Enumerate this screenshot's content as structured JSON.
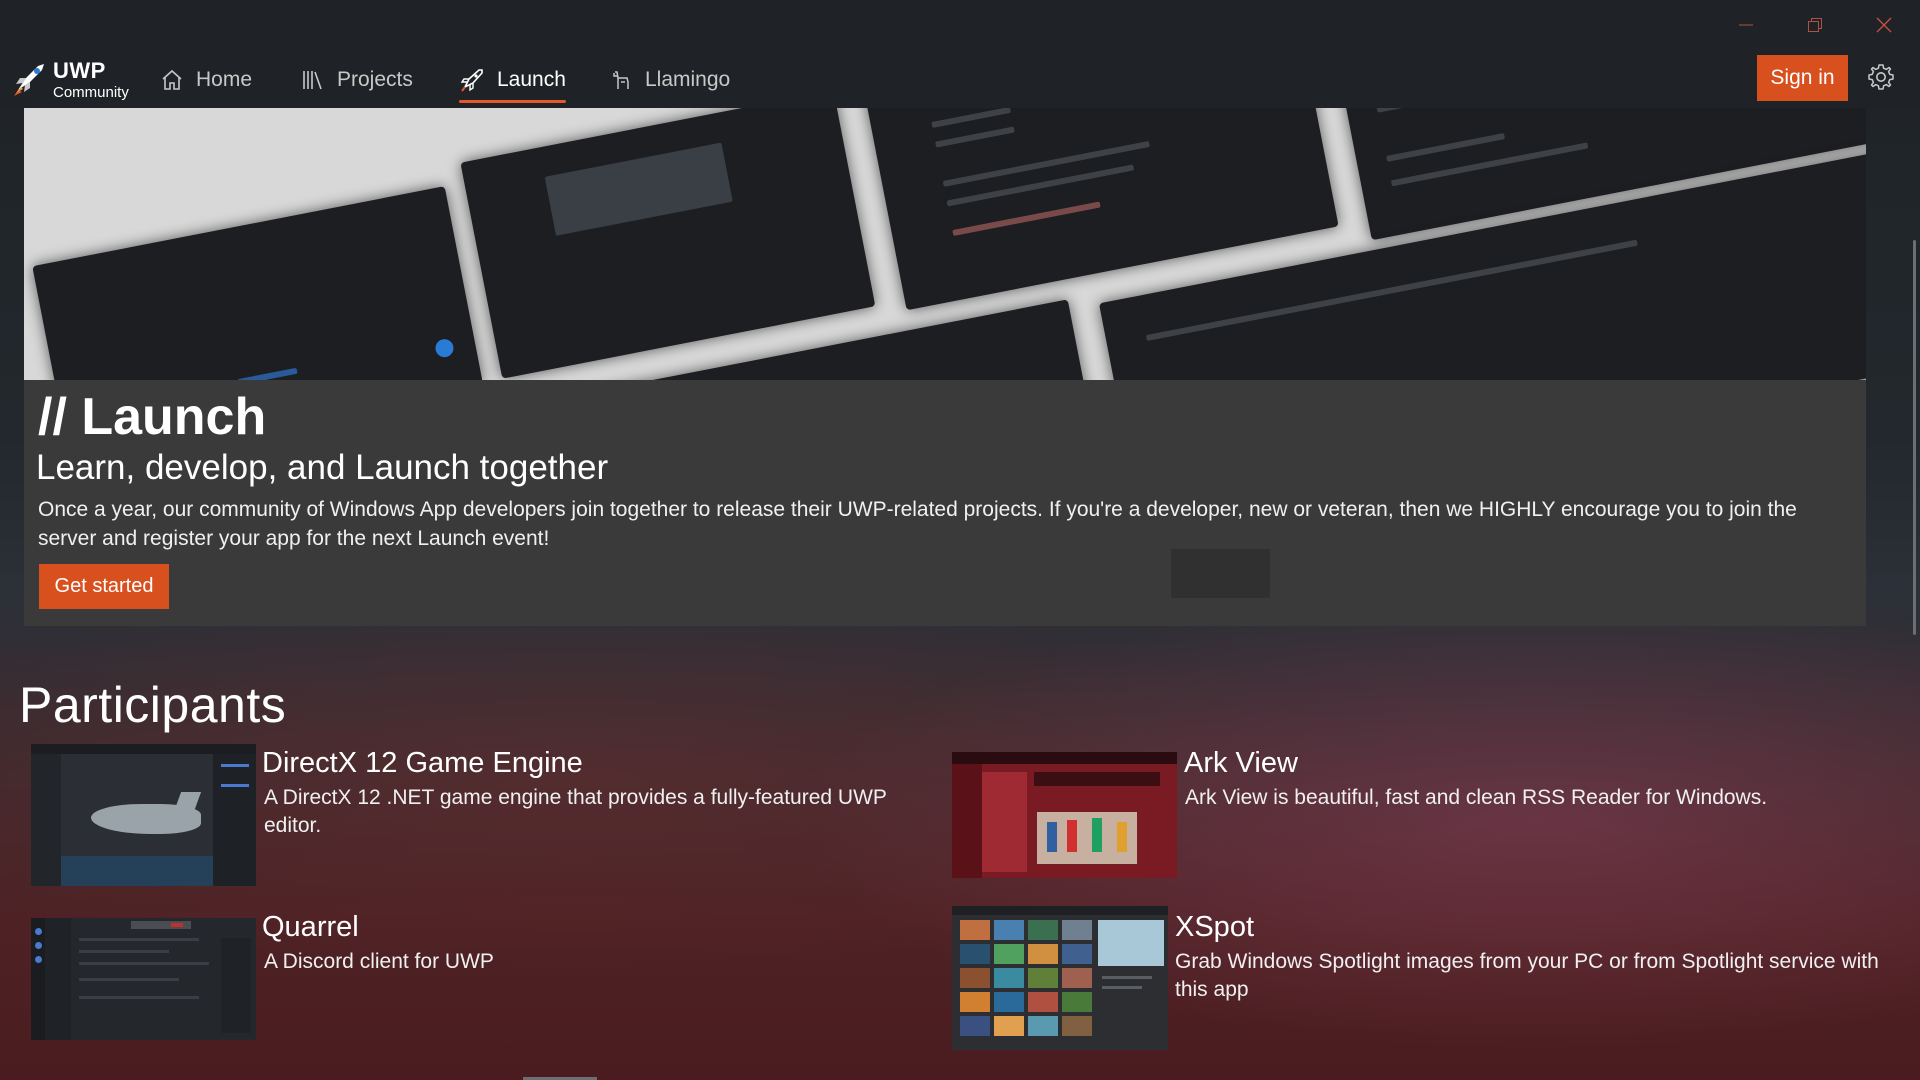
{
  "window": {
    "controls": [
      "minimize",
      "restore",
      "close"
    ]
  },
  "app": {
    "brand_name": "UWP",
    "brand_sub": "Community",
    "accent": "#d9501f"
  },
  "nav": {
    "items": [
      {
        "label": "Home",
        "icon": "home-icon",
        "active": false
      },
      {
        "label": "Projects",
        "icon": "library-icon",
        "active": false
      },
      {
        "label": "Launch",
        "icon": "rocket-icon",
        "active": true
      },
      {
        "label": "Llamingo",
        "icon": "llama-icon",
        "active": false
      }
    ],
    "sign_in": "Sign in",
    "settings_icon": "gear-icon"
  },
  "hero": {
    "title": "// Launch",
    "subtitle": "Learn, develop, and Launch together",
    "description": "Once a year, our community of Windows App developers join together to release their UWP-related projects. If you're a developer, new or veteran, then we HIGHLY encourage you to join the server and register your app for the next Launch event!",
    "cta": "Get started"
  },
  "participants": {
    "heading": "Participants",
    "items": [
      {
        "title": "DirectX 12 Game Engine",
        "description": "A DirectX 12 .NET game engine that provides a fully-featured UWP editor."
      },
      {
        "title": "Ark View",
        "description": "Ark View is beautiful, fast and clean RSS Reader for Windows."
      },
      {
        "title": "Quarrel",
        "description": "A Discord client for UWP"
      },
      {
        "title": "XSpot",
        "description": "Grab Windows Spotlight images from your PC or from Spotlight service with this app"
      }
    ]
  }
}
